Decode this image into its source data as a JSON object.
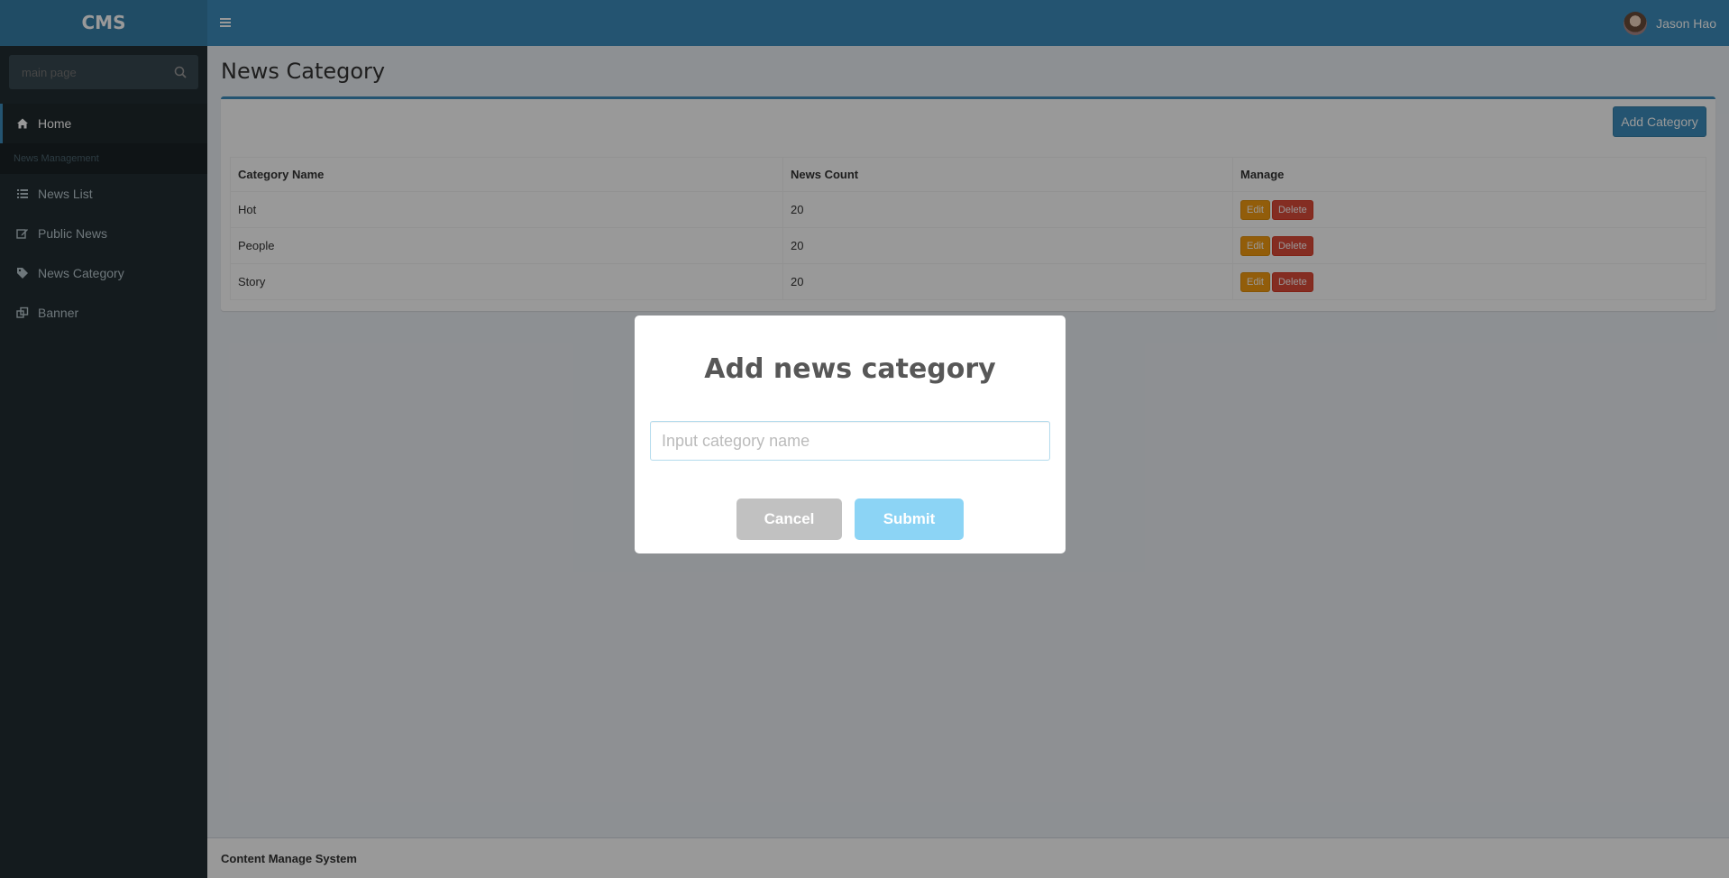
{
  "header": {
    "logo": "CMS",
    "user_name": "Jason Hao"
  },
  "sidebar": {
    "search_placeholder": "main page",
    "home": "Home",
    "section_header": "News Management",
    "items": [
      {
        "label": "News List",
        "icon": "list-icon"
      },
      {
        "label": "Public News",
        "icon": "edit-icon"
      },
      {
        "label": "News Category",
        "icon": "tag-icon"
      },
      {
        "label": "Banner",
        "icon": "clone-icon"
      }
    ]
  },
  "main": {
    "page_title": "News Category",
    "add_button": "Add Category",
    "table": {
      "headers": [
        "Category Name",
        "News Count",
        "Manage"
      ],
      "rows": [
        {
          "name": "Hot",
          "count": "20"
        },
        {
          "name": "People",
          "count": "20"
        },
        {
          "name": "Story",
          "count": "20"
        }
      ],
      "edit_label": "Edit",
      "delete_label": "Delete"
    }
  },
  "footer": {
    "text": "Content Manage System"
  },
  "modal": {
    "title": "Add news category",
    "input_placeholder": "Input category name",
    "input_value": "",
    "cancel_label": "Cancel",
    "submit_label": "Submit"
  },
  "colors": {
    "primary": "#3c8dbc",
    "sidebar_bg": "#222d32",
    "edit": "#f39c12",
    "delete": "#dd4b39",
    "submit": "#8cd4f5",
    "cancel": "#c1c1c1"
  }
}
